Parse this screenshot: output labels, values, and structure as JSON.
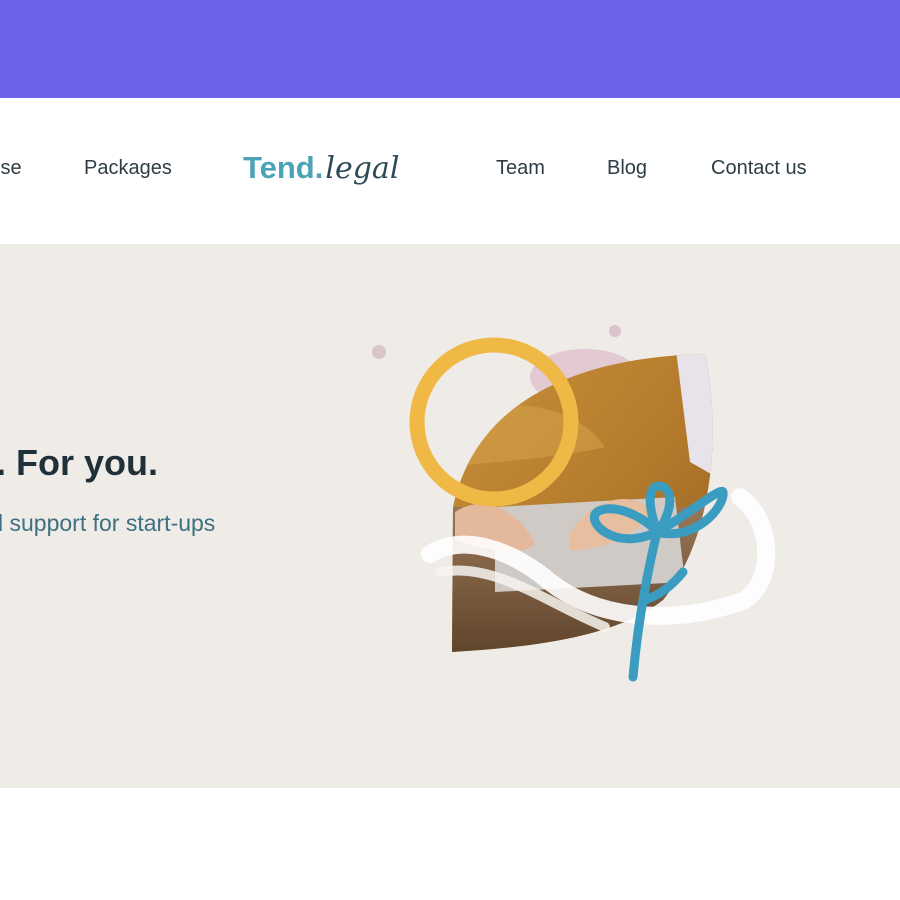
{
  "nav": {
    "links_left": [
      "ise",
      "Packages"
    ],
    "links_right": [
      "Team",
      "Blog",
      "Contact us"
    ]
  },
  "logo": {
    "main": "Tend",
    "dot": ".",
    "script": "legal"
  },
  "hero": {
    "title": ". For you.",
    "subtitle": "l support for start-ups"
  },
  "colors": {
    "banner": "#6c63ea",
    "hero_bg": "#efece8",
    "brand_teal": "#4aa3b6",
    "accent_yellow": "#f0b845",
    "accent_blue": "#3a9cc0"
  }
}
